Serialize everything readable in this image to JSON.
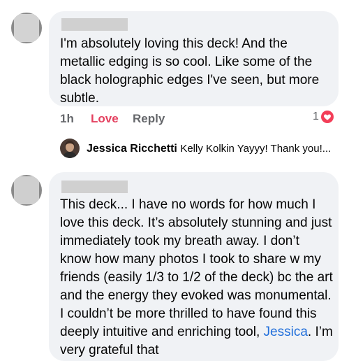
{
  "comment1": {
    "text": "I'm absolutely loving this deck! And the metallic edging is so cool. Like some of the black holographic edges I've seen, but more subtle.",
    "time": "1h",
    "love_label": "Love",
    "reply_label": "Reply",
    "reaction_count": "1",
    "reaction_icon": "heart-icon",
    "reaction_color": "#f33e58"
  },
  "reply": {
    "author": "Jessica Ricchetti",
    "text": "Kelly Kolkin Yayyy! Thank you!..."
  },
  "comment2": {
    "text_before": "This deck... I have no words for how much I love this deck. It’s absolutely stunning and just immediately took my breath away. I don’t know how many photos I took to share w my friends (easily 1/3 to 1/2 of the deck) bc the art and the energy they evoked was monumental. I couldn’t be more thrilled to have found this deeply intuitive and enriching tool,",
    "mention": "Jessica",
    "text_after": ". I’m very grateful that"
  },
  "colors": {
    "bubble": "#f0f2f5",
    "love": "#e4405f",
    "mention": "#216fdb",
    "meta": "#65676b"
  }
}
